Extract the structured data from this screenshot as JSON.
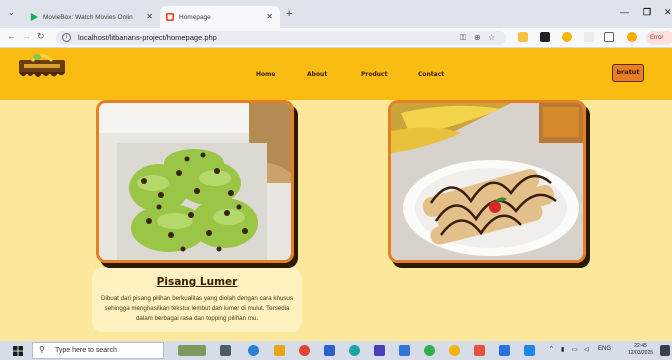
{
  "browser": {
    "tabs": [
      {
        "title": "MovieBox: Watch Movies Onlin",
        "active": false
      },
      {
        "title": "Homepage",
        "active": true
      }
    ],
    "address_url": "localhost/litbanans-project/homepage.php",
    "error_label": "Error"
  },
  "site": {
    "nav": [
      "Home",
      "About",
      "Product",
      "Contact"
    ],
    "cart_label": "bratut",
    "colors": {
      "header": "#f8bc12",
      "page_bg": "#fbe89a",
      "accent": "#e67e22",
      "text": "#3b1c00"
    }
  },
  "products": [
    {
      "name": "Pisang Lumer",
      "description": "Dibuat dari pisang pilihan berkualitas yang diolah dengan cara khusus sehingga menghasilkan tekstur lembut dan lumer di mulut. Tersedia dalam berbagai rasa dan topping pilihan mu."
    }
  ],
  "taskbar": {
    "search_placeholder": "Type here to search",
    "language": "ENG",
    "time": "22:45",
    "date": "12/03/2025"
  }
}
